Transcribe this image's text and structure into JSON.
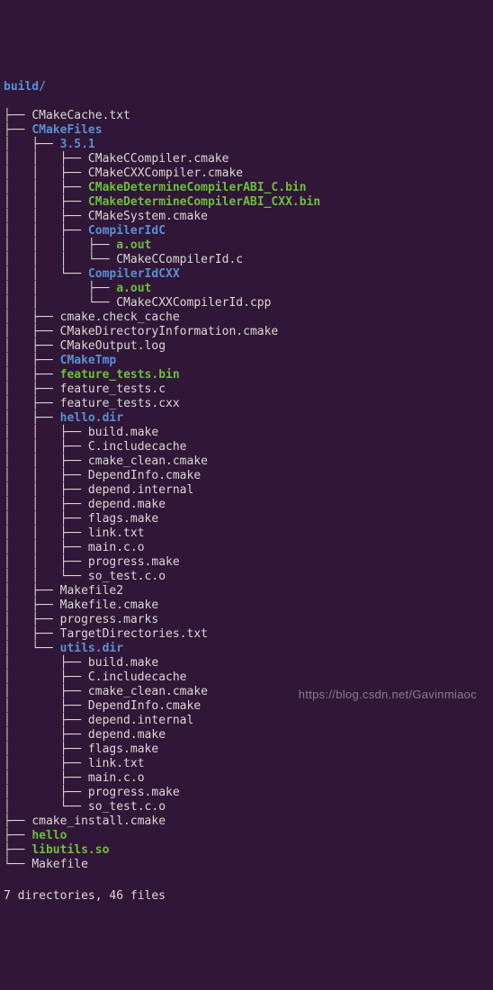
{
  "topbar_fragment": "  . . . . . . .  ,.,,.,,.,,,,,,,,,.,,.,,,,,,,,,,.,,.   .",
  "root_label": "build/",
  "lines": [
    {
      "prefix": "├── ",
      "name": "CMakeCache.txt",
      "cls": ""
    },
    {
      "prefix": "├── ",
      "name": "CMakeFiles",
      "cls": "dir"
    },
    {
      "prefix": "│   ├── ",
      "name": "3.5.1",
      "cls": "dir"
    },
    {
      "prefix": "│   │   ├── ",
      "name": "CMakeCCompiler.cmake",
      "cls": ""
    },
    {
      "prefix": "│   │   ├── ",
      "name": "CMakeCXXCompiler.cmake",
      "cls": ""
    },
    {
      "prefix": "│   │   ├── ",
      "name": "CMakeDetermineCompilerABI_C.bin",
      "cls": "exe"
    },
    {
      "prefix": "│   │   ├── ",
      "name": "CMakeDetermineCompilerABI_CXX.bin",
      "cls": "exe"
    },
    {
      "prefix": "│   │   ├── ",
      "name": "CMakeSystem.cmake",
      "cls": ""
    },
    {
      "prefix": "│   │   ├── ",
      "name": "CompilerIdC",
      "cls": "dir"
    },
    {
      "prefix": "│   │   │   ├── ",
      "name": "a.out",
      "cls": "exe"
    },
    {
      "prefix": "│   │   │   └── ",
      "name": "CMakeCCompilerId.c",
      "cls": ""
    },
    {
      "prefix": "│   │   └── ",
      "name": "CompilerIdCXX",
      "cls": "dir"
    },
    {
      "prefix": "│   │       ├── ",
      "name": "a.out",
      "cls": "exe"
    },
    {
      "prefix": "│   │       └── ",
      "name": "CMakeCXXCompilerId.cpp",
      "cls": ""
    },
    {
      "prefix": "│   ├── ",
      "name": "cmake.check_cache",
      "cls": ""
    },
    {
      "prefix": "│   ├── ",
      "name": "CMakeDirectoryInformation.cmake",
      "cls": ""
    },
    {
      "prefix": "│   ├── ",
      "name": "CMakeOutput.log",
      "cls": ""
    },
    {
      "prefix": "│   ├── ",
      "name": "CMakeTmp",
      "cls": "dir"
    },
    {
      "prefix": "│   ├── ",
      "name": "feature_tests.bin",
      "cls": "exe"
    },
    {
      "prefix": "│   ├── ",
      "name": "feature_tests.c",
      "cls": ""
    },
    {
      "prefix": "│   ├── ",
      "name": "feature_tests.cxx",
      "cls": ""
    },
    {
      "prefix": "│   ├── ",
      "name": "hello.dir",
      "cls": "dir"
    },
    {
      "prefix": "│   │   ├── ",
      "name": "build.make",
      "cls": ""
    },
    {
      "prefix": "│   │   ├── ",
      "name": "C.includecache",
      "cls": ""
    },
    {
      "prefix": "│   │   ├── ",
      "name": "cmake_clean.cmake",
      "cls": ""
    },
    {
      "prefix": "│   │   ├── ",
      "name": "DependInfo.cmake",
      "cls": ""
    },
    {
      "prefix": "│   │   ├── ",
      "name": "depend.internal",
      "cls": ""
    },
    {
      "prefix": "│   │   ├── ",
      "name": "depend.make",
      "cls": ""
    },
    {
      "prefix": "│   │   ├── ",
      "name": "flags.make",
      "cls": ""
    },
    {
      "prefix": "│   │   ├── ",
      "name": "link.txt",
      "cls": ""
    },
    {
      "prefix": "│   │   ├── ",
      "name": "main.c.o",
      "cls": ""
    },
    {
      "prefix": "│   │   ├── ",
      "name": "progress.make",
      "cls": ""
    },
    {
      "prefix": "│   │   └── ",
      "name": "so_test.c.o",
      "cls": ""
    },
    {
      "prefix": "│   ├── ",
      "name": "Makefile2",
      "cls": ""
    },
    {
      "prefix": "│   ├── ",
      "name": "Makefile.cmake",
      "cls": ""
    },
    {
      "prefix": "│   ├── ",
      "name": "progress.marks",
      "cls": ""
    },
    {
      "prefix": "│   ├── ",
      "name": "TargetDirectories.txt",
      "cls": ""
    },
    {
      "prefix": "│   └── ",
      "name": "utils.dir",
      "cls": "dir"
    },
    {
      "prefix": "│       ├── ",
      "name": "build.make",
      "cls": ""
    },
    {
      "prefix": "│       ├── ",
      "name": "C.includecache",
      "cls": ""
    },
    {
      "prefix": "│       ├── ",
      "name": "cmake_clean.cmake",
      "cls": ""
    },
    {
      "prefix": "│       ├── ",
      "name": "DependInfo.cmake",
      "cls": ""
    },
    {
      "prefix": "│       ├── ",
      "name": "depend.internal",
      "cls": ""
    },
    {
      "prefix": "│       ├── ",
      "name": "depend.make",
      "cls": ""
    },
    {
      "prefix": "│       ├── ",
      "name": "flags.make",
      "cls": ""
    },
    {
      "prefix": "│       ├── ",
      "name": "link.txt",
      "cls": ""
    },
    {
      "prefix": "│       ├── ",
      "name": "main.c.o",
      "cls": ""
    },
    {
      "prefix": "│       ├── ",
      "name": "progress.make",
      "cls": ""
    },
    {
      "prefix": "│       └── ",
      "name": "so_test.c.o",
      "cls": ""
    },
    {
      "prefix": "├── ",
      "name": "cmake_install.cmake",
      "cls": ""
    },
    {
      "prefix": "├── ",
      "name": "hello",
      "cls": "exe"
    },
    {
      "prefix": "├── ",
      "name": "libutils.so",
      "cls": "exe"
    },
    {
      "prefix": "└── ",
      "name": "Makefile",
      "cls": ""
    }
  ],
  "summary": "7 directories, 46 files",
  "watermark": "https://blog.csdn.net/Gavinmiaoc"
}
